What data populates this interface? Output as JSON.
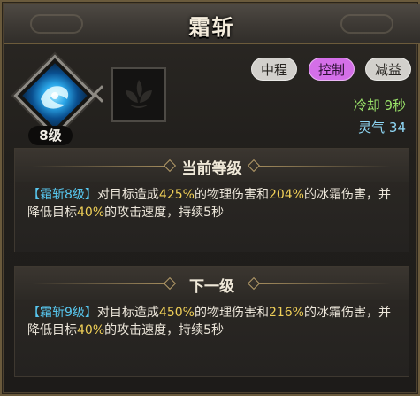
{
  "window": {
    "title": "霜斩"
  },
  "skill": {
    "level_label": "8级",
    "icon": "ice-slash-icon",
    "locked_icon": "lotus-icon"
  },
  "tags": [
    "中程",
    "控制",
    "减益"
  ],
  "stats": {
    "cooldown": "冷却 9秒",
    "qi": "灵气 34"
  },
  "current_level": {
    "header": "当前等级",
    "name": "【霜斩8级】",
    "text_1": "对目标造成",
    "value_1": "425%",
    "text_2": "的物理伤害和",
    "value_2": "204%",
    "text_3": "的冰霜伤害，并降低目标",
    "value_3": "40%",
    "text_4": "的攻击速度，持续5秒"
  },
  "next_level": {
    "header": "下一级",
    "name": "【霜斩9级】",
    "text_1": "对目标造成",
    "value_1": "450%",
    "text_2": "的物理伤害和",
    "value_2": "216%",
    "text_3": "的冰霜伤害，并降低目标",
    "value_3": "40%",
    "text_4": "的攻击速度，持续5秒"
  },
  "colors": {
    "skill_name": "#58c8f0",
    "highlight": "#f0d058",
    "control_tag": "#d46fe8",
    "cooldown": "#9be36a",
    "qi": "#8fd7f5"
  }
}
